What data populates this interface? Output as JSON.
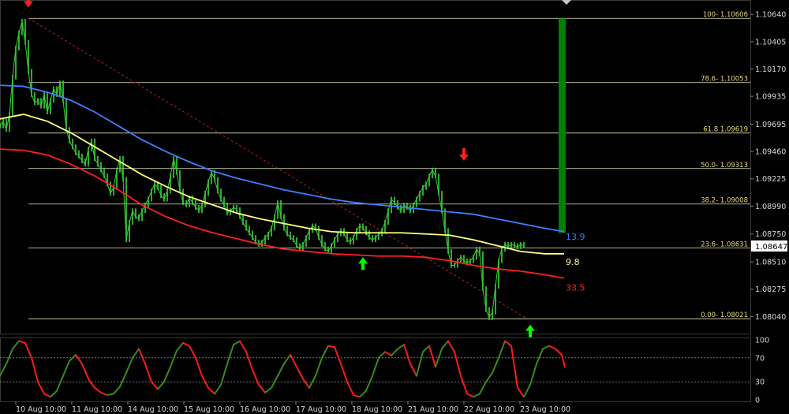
{
  "chart_data": [
    {
      "type": "line",
      "title": "",
      "ylim": [
        1.079,
        1.1075
      ],
      "x_tick_labels": [
        "10 Aug 10:00",
        "11 Aug 10:00",
        "14 Aug 10:00",
        "15 Aug 10:00",
        "16 Aug 10:00",
        "17 Aug 10:00",
        "18 Aug 10:00",
        "21 Aug 10:00",
        "22 Aug 10:00",
        "23 Aug 10:00"
      ],
      "y_tick_labels": [
        "1.10640",
        "1.10405",
        "1.10170",
        "1.09935",
        "1.09695",
        "1.09460",
        "1.09225",
        "1.08990",
        "1.08750",
        "1.08510",
        "1.08275",
        "1.08040"
      ],
      "current_price": "1.08647",
      "fib_levels": [
        {
          "label": "100- 1.10606",
          "value": 1.10606
        },
        {
          "label": "78.6- 1.10053",
          "value": 1.10053
        },
        {
          "label": "61.8 1.09619",
          "value": 1.09619
        },
        {
          "label": "50.0- 1.09313",
          "value": 1.09313
        },
        {
          "label": "38.2- 1.09008",
          "value": 1.09008
        },
        {
          "label": "23.6- 1.08631",
          "value": 1.08631
        },
        {
          "label": "0.00- 1.08021",
          "value": 1.08021
        }
      ],
      "price_x": [
        0,
        4,
        8,
        12,
        16,
        20,
        24,
        28,
        32,
        36,
        40,
        44,
        48,
        52,
        56,
        60,
        64,
        68,
        72,
        76,
        80,
        84,
        88,
        92,
        96,
        100,
        104,
        108,
        112,
        116,
        120,
        124,
        128,
        132,
        136,
        140,
        144,
        148,
        152,
        156,
        160,
        164,
        168,
        172,
        176,
        180,
        184,
        188,
        192,
        196,
        200,
        204,
        208,
        212,
        216,
        220,
        224,
        228,
        232,
        236,
        240,
        244,
        248,
        252,
        256,
        260,
        264,
        268,
        272,
        276,
        280,
        284,
        288,
        292,
        296,
        300,
        304,
        308,
        312,
        316,
        320,
        324,
        328,
        332,
        336,
        340,
        344,
        348,
        352,
        356,
        360,
        364,
        368,
        372,
        376,
        380,
        384,
        388,
        392,
        396,
        400,
        404,
        408,
        412,
        416,
        420,
        424,
        428,
        432,
        436,
        440,
        444,
        448,
        452,
        456,
        460,
        464,
        468,
        472,
        476,
        480,
        484,
        488,
        492,
        496,
        500,
        504,
        508,
        512,
        516,
        520,
        524,
        528,
        532,
        536,
        540,
        544,
        548,
        552,
        556,
        560,
        564,
        568,
        572,
        576,
        580,
        584,
        588,
        592,
        596,
        600,
        604,
        608,
        612,
        616,
        620,
        624,
        628,
        632,
        636,
        640,
        644,
        648,
        652,
        656,
        660,
        664,
        668,
        672,
        676,
        680,
        684,
        688,
        692,
        696,
        700,
        704,
        708,
        712
      ],
      "price_y": [
        1.0968,
        1.0972,
        1.0965,
        1.0978,
        1.101,
        1.1035,
        1.1048,
        1.1058,
        1.104,
        1.1015,
        1.0995,
        1.0988,
        1.099,
        1.0985,
        1.0995,
        1.098,
        1.099,
        1.1,
        1.0995,
        1.1005,
        1.099,
        1.0965,
        1.0955,
        1.095,
        1.0945,
        1.0942,
        1.0938,
        1.0935,
        1.0948,
        1.0955,
        1.094,
        1.0935,
        1.093,
        1.0925,
        1.0918,
        1.091,
        1.0915,
        1.093,
        1.094,
        1.0922,
        1.087,
        1.0885,
        1.0895,
        1.089,
        1.0888,
        1.0895,
        1.09,
        1.0905,
        1.0912,
        1.0918,
        1.0915,
        1.0908,
        1.0905,
        1.0912,
        1.0925,
        1.094,
        1.0928,
        1.0912,
        1.0902,
        1.09,
        1.0906,
        1.0902,
        1.0898,
        1.0895,
        1.09,
        1.091,
        1.092,
        1.0928,
        1.0922,
        1.0912,
        1.0905,
        1.09,
        1.0893,
        1.0895,
        1.0898,
        1.0896,
        1.089,
        1.0885,
        1.088,
        1.0876,
        1.0872,
        1.0868,
        1.0866,
        1.0868,
        1.0872,
        1.0875,
        1.088,
        1.089,
        1.0902,
        1.089,
        1.088,
        1.0875,
        1.0872,
        1.087,
        1.0865,
        1.0862,
        1.0866,
        1.0872,
        1.0878,
        1.0882,
        1.088,
        1.0872,
        1.0866,
        1.0862,
        1.086,
        1.0865,
        1.087,
        1.0875,
        1.0878,
        1.0875,
        1.087,
        1.0868,
        1.0872,
        1.0878,
        1.0882,
        1.088,
        1.0876,
        1.0872,
        1.087,
        1.0872,
        1.0875,
        1.0878,
        1.0885,
        1.0895,
        1.0905,
        1.0902,
        1.0898,
        1.0895,
        1.09,
        1.0898,
        1.0895,
        1.09,
        1.0905,
        1.091,
        1.0915,
        1.0918,
        1.0925,
        1.093,
        1.0925,
        1.091,
        1.0895,
        1.0878,
        1.086,
        1.0848,
        1.0848,
        1.0852,
        1.0855,
        1.0852,
        1.085,
        1.0852,
        1.0855,
        1.0862,
        1.0858,
        1.0828,
        1.081,
        1.0803,
        1.0808,
        1.083,
        1.0852,
        1.0862,
        1.0866,
        1.0864,
        1.0866,
        1.0865,
        1.0864,
        1.0866,
        1.0865
      ],
      "overlay_lines": [
        {
          "x": [
            0,
            30,
            60,
            90,
            120,
            150,
            180,
            210,
            240,
            270,
            300,
            330,
            360,
            390,
            420,
            450,
            480,
            510,
            540,
            570,
            600,
            630,
            660,
            690,
            715
          ],
          "y": [
            1.1003,
            1.1002,
            1.0997,
            1.099,
            1.098,
            1.0968,
            1.0956,
            1.0946,
            1.0937,
            1.0929,
            1.0923,
            1.0918,
            1.0913,
            1.0909,
            1.0905,
            1.0902,
            1.09,
            1.0898,
            1.0896,
            1.0894,
            1.0892,
            1.0888,
            1.0884,
            1.088,
            1.0877
          ],
          "color": "#3f7fff",
          "end_label": "13.9"
        },
        {
          "x": [
            0,
            30,
            60,
            90,
            120,
            150,
            180,
            210,
            240,
            270,
            300,
            330,
            360,
            390,
            420,
            450,
            480,
            510,
            540,
            570,
            600,
            630,
            660,
            690,
            715
          ],
          "y": [
            1.0974,
            1.0978,
            1.0972,
            1.0962,
            1.095,
            1.0938,
            1.0926,
            1.0916,
            1.0907,
            1.09,
            1.0893,
            1.0888,
            1.0884,
            1.088,
            1.0877,
            1.0876,
            1.0876,
            1.0876,
            1.0875,
            1.0874,
            1.087,
            1.0865,
            1.086,
            1.0858,
            1.0858
          ],
          "color": "#ffff80",
          "end_label": "9.8"
        },
        {
          "x": [
            0,
            30,
            60,
            90,
            120,
            150,
            180,
            210,
            240,
            270,
            300,
            330,
            360,
            390,
            420,
            450,
            480,
            510,
            540,
            570,
            600,
            630,
            660,
            690,
            715
          ],
          "y": [
            1.0948,
            1.0947,
            1.0943,
            1.0935,
            1.0925,
            1.0913,
            1.09,
            1.089,
            1.0882,
            1.0876,
            1.0871,
            1.0866,
            1.0862,
            1.086,
            1.0858,
            1.0857,
            1.0856,
            1.0856,
            1.0855,
            1.0852,
            1.0848,
            1.0845,
            1.0843,
            1.084,
            1.0837
          ],
          "color": "#ff2020",
          "end_label": "33.5"
        }
      ],
      "trendline": {
        "x": [
          36,
          668
        ],
        "y": [
          1.10606,
          1.08021
        ],
        "color": "#b22222"
      },
      "green_bar": {
        "x": 712,
        "y_top": 1.10606,
        "y_bottom": 1.0876,
        "color": "#008000"
      },
      "markers": [
        {
          "type": "down-arrow",
          "color": "#ff2020",
          "x": 36,
          "y": 1.107
        },
        {
          "type": "up-arrow",
          "color": "#00ff00",
          "x": 460,
          "y": 1.0855
        },
        {
          "type": "down-arrow",
          "color": "#ff2020",
          "x": 588,
          "y": 1.0938
        },
        {
          "type": "up-arrow",
          "color": "#00ff00",
          "x": 672,
          "y": 1.0797
        }
      ]
    },
    {
      "type": "line",
      "title": "",
      "ylim": [
        0,
        100
      ],
      "y_tick_labels": [
        "100",
        "70",
        "30",
        "0"
      ],
      "levels": [
        70,
        30
      ],
      "oscillator_x": [
        0,
        8,
        16,
        24,
        32,
        40,
        48,
        56,
        64,
        72,
        80,
        88,
        96,
        104,
        112,
        120,
        128,
        136,
        144,
        152,
        160,
        168,
        176,
        184,
        192,
        200,
        208,
        216,
        224,
        232,
        240,
        248,
        256,
        264,
        272,
        280,
        288,
        296,
        304,
        312,
        320,
        328,
        336,
        344,
        352,
        360,
        368,
        376,
        384,
        392,
        400,
        408,
        416,
        424,
        432,
        440,
        448,
        456,
        464,
        472,
        480,
        488,
        496,
        504,
        512,
        520,
        528,
        536,
        544,
        552,
        560,
        568,
        576,
        584,
        592,
        600,
        608,
        616,
        624,
        632,
        640,
        648,
        656,
        664,
        672,
        680,
        688,
        696,
        704,
        712,
        716
      ],
      "oscillator_y": [
        40,
        60,
        85,
        98,
        95,
        70,
        30,
        10,
        5,
        15,
        40,
        65,
        75,
        60,
        35,
        20,
        12,
        8,
        10,
        22,
        45,
        70,
        85,
        60,
        30,
        18,
        30,
        55,
        82,
        95,
        90,
        70,
        40,
        20,
        10,
        25,
        60,
        92,
        98,
        80,
        50,
        25,
        12,
        20,
        40,
        60,
        75,
        55,
        35,
        20,
        40,
        70,
        90,
        88,
        60,
        30,
        8,
        5,
        15,
        40,
        70,
        80,
        74,
        85,
        92,
        60,
        40,
        80,
        90,
        55,
        85,
        98,
        80,
        40,
        10,
        5,
        10,
        30,
        45,
        70,
        98,
        90,
        20,
        5,
        25,
        60,
        85,
        90,
        85,
        75,
        55
      ],
      "oscillator_up_color": "#3a8a1a",
      "oscillator_down_color": "#ff1a1a"
    }
  ]
}
